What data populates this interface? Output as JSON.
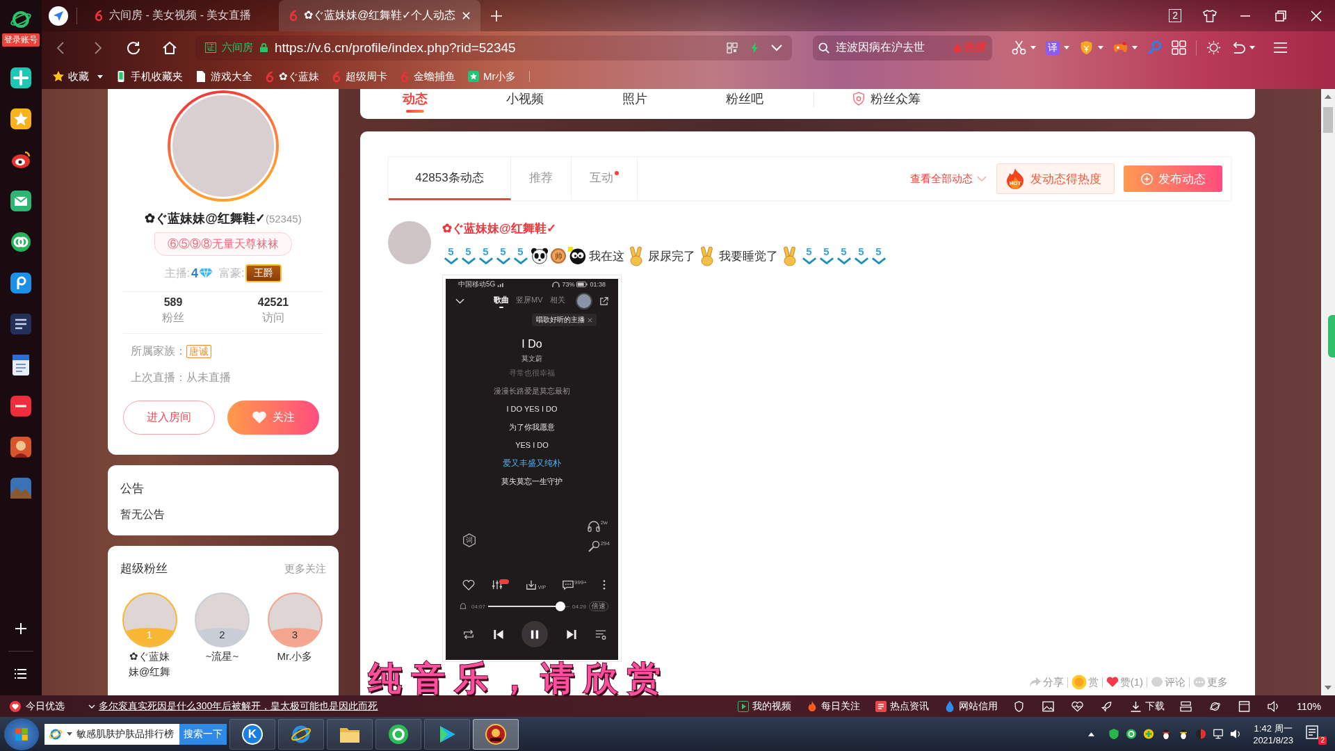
{
  "sidebar": {
    "login_label": "登录账号"
  },
  "tabs": [
    {
      "title": "六间房 - 美女视频 - 美女直播",
      "selected": false
    },
    {
      "title": "✿ぐ蓝妹妹@红舞鞋✓个人动态",
      "selected": true
    }
  ],
  "window_controls": {
    "tab_count": "2"
  },
  "address_bar": {
    "cert_badge": "证",
    "site_name": "六间房",
    "url": "https://v.6.cn/profile/index.php?rid=52345"
  },
  "search": {
    "value": "连波因病在沪去世",
    "hot_tag": "热搜"
  },
  "toolbar": {
    "translate_label": "译"
  },
  "bookmarks": [
    {
      "label": "收藏",
      "kind": "star"
    },
    {
      "label": "手机收藏夹",
      "kind": "phone"
    },
    {
      "label": "游戏大全",
      "kind": "doc"
    },
    {
      "label": "✿ぐ蓝妹",
      "kind": "logo"
    },
    {
      "label": "超级周卡",
      "kind": "logo"
    },
    {
      "label": "金蟾捕鱼",
      "kind": "logo"
    },
    {
      "label": "Mr小多",
      "kind": "app"
    }
  ],
  "profile": {
    "name": "✿ぐ蓝妹妹@红舞鞋✓",
    "rid": "(52345)",
    "motto": "⑥⑤⑨⑧无量天尊袜袜",
    "anchor_label": "主播:",
    "anchor_level": "4",
    "rich_label": "富豪:",
    "rich_title": "王爵",
    "stats": [
      {
        "value": "589",
        "label": "粉丝"
      },
      {
        "value": "42521",
        "label": "访问"
      }
    ],
    "family_label": "所属家族：",
    "family": "唐诚",
    "last_live": "上次直播：从未直播",
    "buttons": [
      {
        "label": "进入房间",
        "kind": "outline"
      },
      {
        "label": "关注",
        "kind": "follow"
      }
    ]
  },
  "notice": {
    "title": "公告",
    "text": "暂无公告"
  },
  "super_fans": {
    "title": "超级粉丝",
    "more": "更多关注",
    "fans": [
      {
        "rank": "1",
        "name": "✿ぐ蓝妹妹@红舞",
        "color": "#f7b733"
      },
      {
        "rank": "2",
        "name": "~流星~",
        "color": "#c9ced6"
      },
      {
        "rank": "3",
        "name": "Mr.小多",
        "color": "#f4a58f"
      }
    ]
  },
  "main_tabs": [
    {
      "label": "动态",
      "selected": true,
      "kind": "plain"
    },
    {
      "label": "小视频",
      "selected": false,
      "kind": "plain"
    },
    {
      "label": "照片",
      "selected": false,
      "kind": "plain"
    },
    {
      "label": "粉丝吧",
      "selected": false,
      "kind": "plain"
    },
    {
      "label": "粉丝众筹",
      "selected": false,
      "kind": "badge"
    }
  ],
  "feed": {
    "tabs": [
      {
        "label": "42853条动态",
        "selected": true,
        "dot": false
      },
      {
        "label": "推荐",
        "selected": false,
        "dot": false
      },
      {
        "label": "互动",
        "selected": false,
        "dot": true
      }
    ],
    "filter": "查看全部动态",
    "hot_icon": "HOT",
    "hot_button": "发动态得热度",
    "post_button": "发布动态"
  },
  "post": {
    "author": "✿ぐ蓝妹妹@红舞鞋✓",
    "content": [
      {
        "kind": "five",
        "text": "5"
      },
      {
        "kind": "five",
        "text": "5"
      },
      {
        "kind": "five",
        "text": "5"
      },
      {
        "kind": "five",
        "text": "5"
      },
      {
        "kind": "five",
        "text": "5"
      },
      {
        "kind": "panda"
      },
      {
        "kind": "coin",
        "text": "帅"
      },
      {
        "kind": "dark_face"
      },
      {
        "kind": "text",
        "text": "我在这"
      },
      {
        "kind": "victory"
      },
      {
        "kind": "text",
        "text": "尿尿完了"
      },
      {
        "kind": "victory"
      },
      {
        "kind": "text",
        "text": "我要睡觉了"
      },
      {
        "kind": "victory"
      },
      {
        "kind": "five",
        "text": "5"
      },
      {
        "kind": "five",
        "text": "5"
      },
      {
        "kind": "five",
        "text": "5"
      },
      {
        "kind": "five",
        "text": "5"
      },
      {
        "kind": "five",
        "text": "5"
      }
    ],
    "image": {
      "status_left": "中国移动5G",
      "battery": "73%",
      "time": "01:38",
      "tabs": [
        {
          "label": "歌曲",
          "selected": true
        },
        {
          "label": "竖屏MV",
          "selected": false
        },
        {
          "label": "相关",
          "selected": false
        }
      ],
      "tip": "唱歌好听的主播",
      "song": "I Do",
      "artist": "莫文蔚",
      "lyrics": [
        {
          "text": "寻常也很幸福",
          "kind": "past"
        },
        {
          "text": "漫漫长路爱是莫忘最初",
          "kind": "dim"
        },
        {
          "text": "I DO YES I DO",
          "kind": "normal"
        },
        {
          "text": "为了你我愿意",
          "kind": "normal"
        },
        {
          "text": "YES I DO",
          "kind": "normal"
        },
        {
          "text": "爱又丰盛又纯朴",
          "kind": "current"
        },
        {
          "text": "莫失莫忘一生守护",
          "kind": "normal"
        }
      ],
      "listen_count": "2w",
      "sing_count": "294",
      "lyric_badge": "词",
      "vip_label": "VIP",
      "comment_count": "999+",
      "elapsed": "04:07",
      "total": "04:29",
      "speed": "倍速",
      "progress": {
        "level": 0.89
      }
    },
    "actions": [
      {
        "label": "分享",
        "kind": "share"
      },
      {
        "label": "赏",
        "kind": "reward"
      },
      {
        "label": "赞(1)",
        "kind": "like"
      },
      {
        "label": "评论",
        "kind": "comment"
      },
      {
        "label": "更多",
        "kind": "more"
      }
    ]
  },
  "overlay_caption": "纯音乐，请欣赏",
  "status_bar": {
    "pick": "今日优选",
    "news": "多尔衮真实死因是什么300年后被解开，皇太极可能也是因此而死",
    "links": [
      {
        "label": "我的视频",
        "kind": "video"
      },
      {
        "label": "每日关注",
        "kind": "fire"
      },
      {
        "label": "热点资讯",
        "kind": "news"
      },
      {
        "label": "网站信用",
        "kind": "drop"
      }
    ],
    "download": "下载",
    "zoom": "110%"
  },
  "taskbar": {
    "search_value": "敏感肌肤护肤品排行榜",
    "search_button": "搜索一下",
    "apps": [
      {
        "kind": "k",
        "text": "K",
        "selected": false
      },
      {
        "kind": "ie",
        "selected": false
      },
      {
        "kind": "folder",
        "selected": false
      },
      {
        "kind": "browser",
        "selected": false
      },
      {
        "kind": "player",
        "selected": false
      },
      {
        "kind": "game",
        "selected": true
      }
    ],
    "time": "1:42 周一",
    "date": "2021/8/23",
    "notifications": "2"
  }
}
